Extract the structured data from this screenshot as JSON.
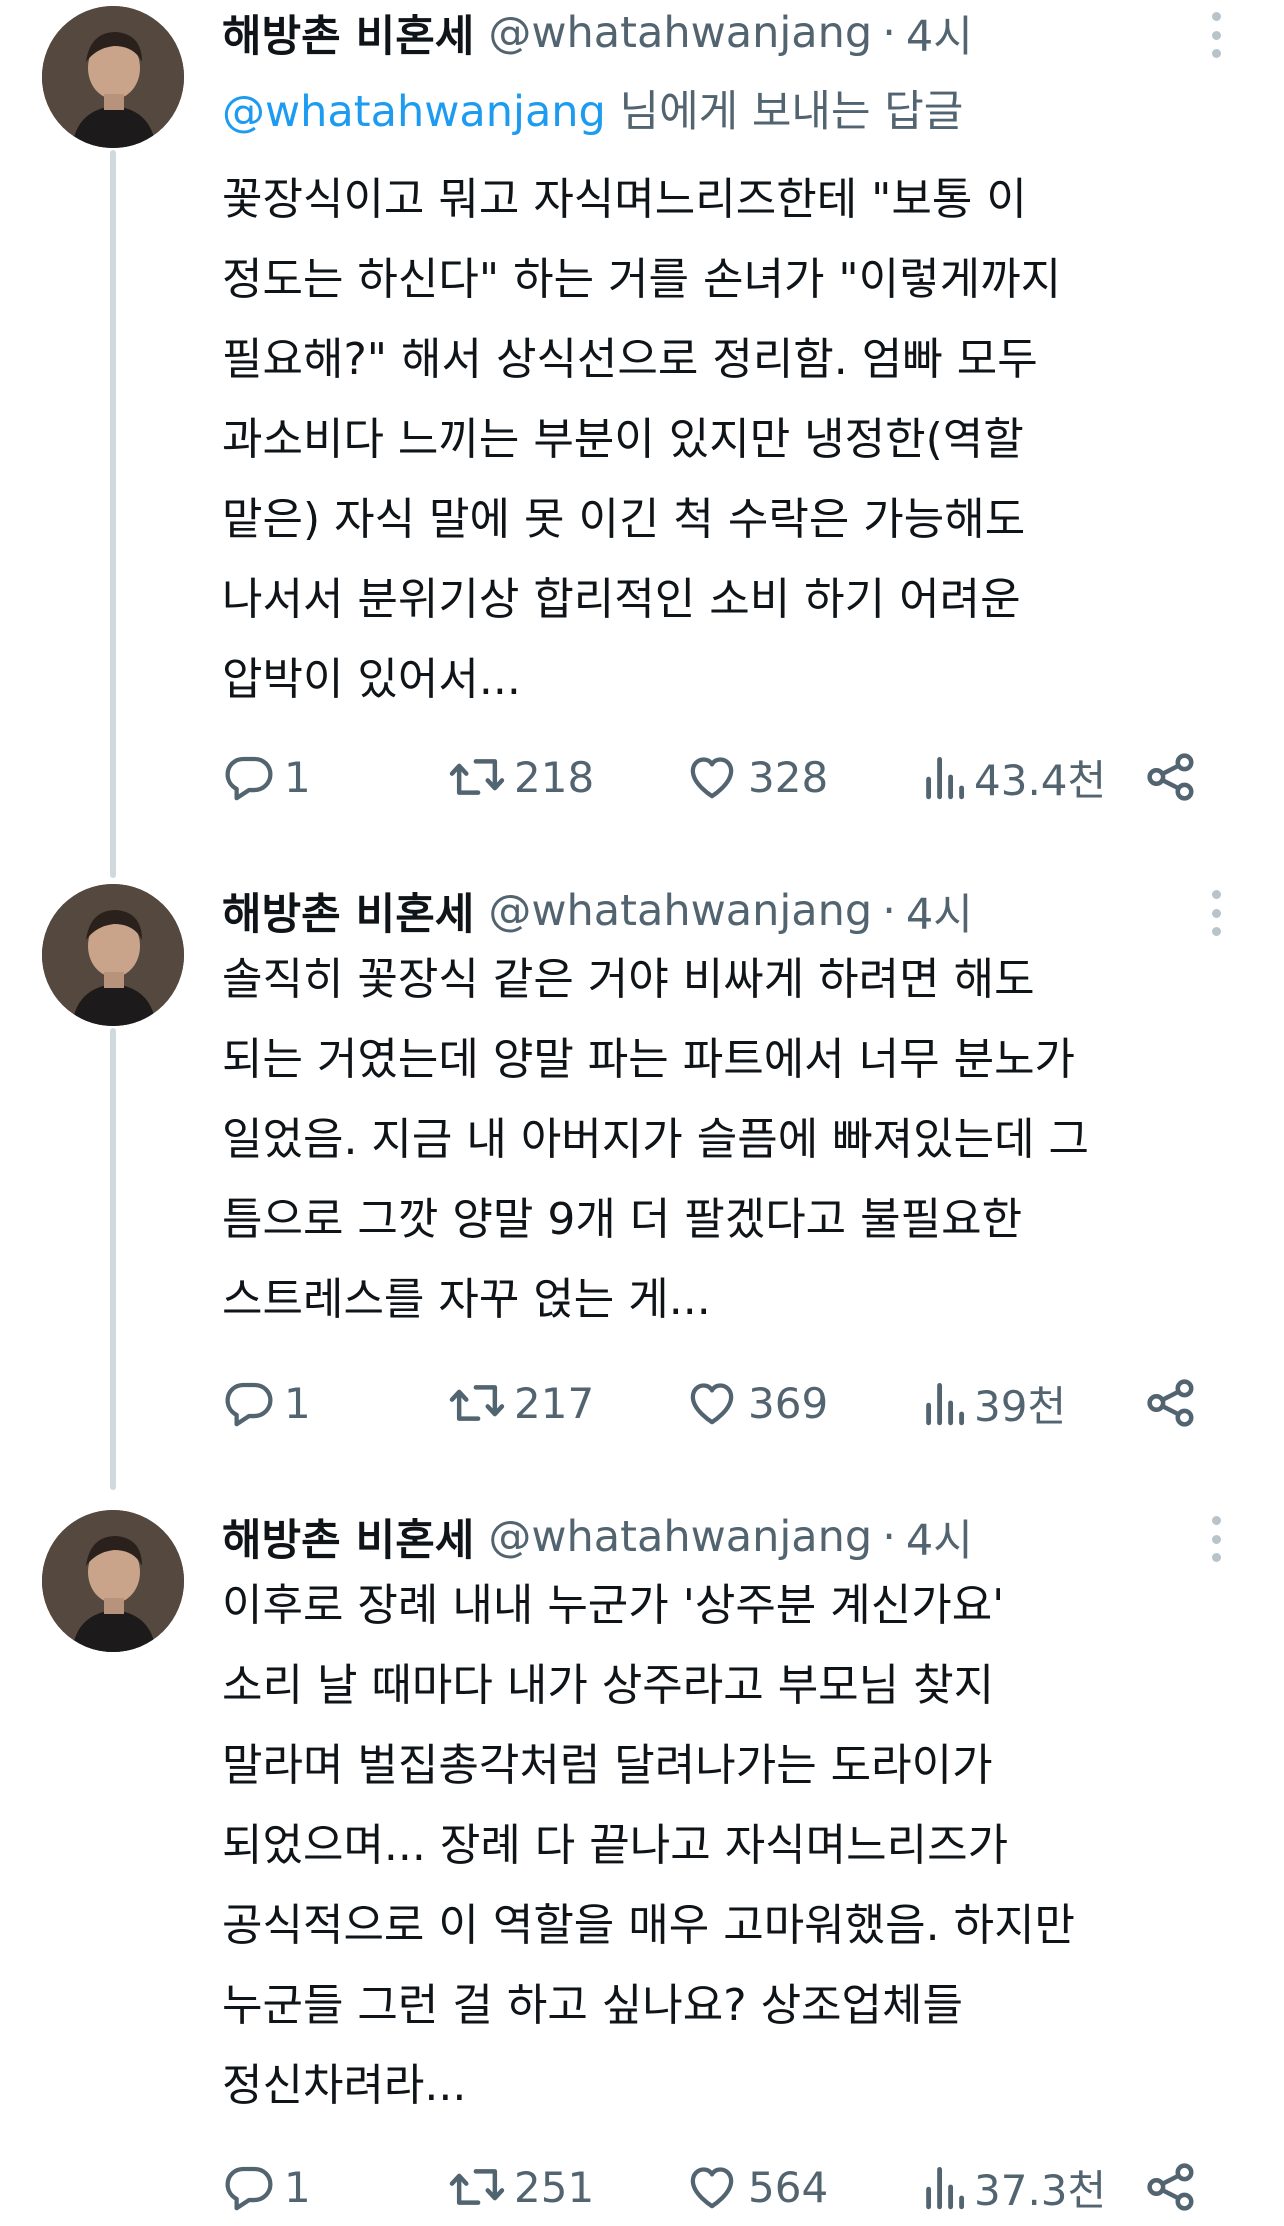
{
  "tweets": [
    {
      "author": {
        "name": "해방촌 비혼세",
        "handle": "@whatahwanjang",
        "time": "4시"
      },
      "reply_to": {
        "mention": "@whatahwanjang",
        "suffix": " 님에게 보내는 답글"
      },
      "lines": [
        "꽃장식이고 뭐고 자식며느리즈한테 \"보통 이",
        "정도는 하신다\" 하는 거를 손녀가 \"이렇게까지",
        "필요해?\" 해서 상식선으로 정리함. 엄빠 모두",
        "과소비다 느끼는 부분이 있지만 냉정한(역할",
        "맡은) 자식 말에 못 이긴 척 수락은 가능해도",
        "나서서 분위기상 합리적인 소비 하기 어려운",
        "압박이 있어서..."
      ],
      "stats": {
        "replies": "1",
        "retweets": "218",
        "likes": "328",
        "views": "43.4천"
      }
    },
    {
      "author": {
        "name": "해방촌 비혼세",
        "handle": "@whatahwanjang",
        "time": "4시"
      },
      "lines": [
        "솔직히 꽃장식 같은 거야 비싸게 하려면 해도",
        "되는 거였는데 양말 파는 파트에서 너무 분노가",
        "일었음. 지금 내 아버지가 슬픔에 빠져있는데 그",
        "틈으로 그깟 양말 9개 더 팔겠다고 불필요한",
        "스트레스를 자꾸 얹는 게..."
      ],
      "stats": {
        "replies": "1",
        "retweets": "217",
        "likes": "369",
        "views": "39천"
      }
    },
    {
      "author": {
        "name": "해방촌 비혼세",
        "handle": "@whatahwanjang",
        "time": "4시"
      },
      "lines": [
        "이후로 장례 내내 누군가 '상주분 계신가요'",
        "소리 날 때마다 내가 상주라고 부모님 찾지",
        "말라며 벌집총각처럼 달려나가는 도라이가",
        "되었으며... 장례 다 끝나고 자식며느리즈가",
        "공식적으로 이 역할을 매우 고마워했음. 하지만",
        "누군들 그런 걸 하고 싶나요? 상조업체들",
        "정신차려라..."
      ],
      "stats": {
        "replies": "1",
        "retweets": "251",
        "likes": "564",
        "views": "37.3천"
      }
    }
  ],
  "colors": {
    "text": "#0f1419",
    "secondary": "#536471",
    "link": "#1d9bf0",
    "thread_line": "#cfd9de"
  },
  "icons": [
    "reply-icon",
    "retweet-icon",
    "like-icon",
    "views-icon",
    "share-icon",
    "more-icon"
  ]
}
